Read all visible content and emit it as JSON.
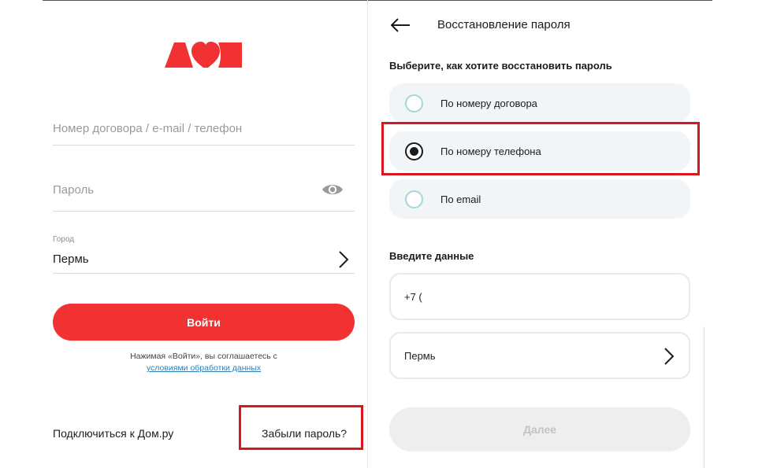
{
  "login": {
    "login_placeholder": "Номер договора / e-mail / телефон",
    "password_placeholder": "Пароль",
    "city_label": "Город",
    "city_value": "Пермь",
    "login_button": "Войти",
    "agreement_text": "Нажимая «Войти», вы соглашаетесь с",
    "terms_link": "условиями обработки данных",
    "connect_link": "Подключиться к Дом.ру",
    "forgot_link": "Забыли пароль?"
  },
  "recovery": {
    "title": "Восстановление пароля",
    "choose_label": "Выберите, как хотите восстановить пароль",
    "options": [
      {
        "label": "По номеру договора",
        "selected": false
      },
      {
        "label": "По номеру телефона",
        "selected": true
      },
      {
        "label": "По email",
        "selected": false
      }
    ],
    "enter_data_label": "Введите данные",
    "phone_value": "+7 (",
    "city_value": "Пермь",
    "next_button": "Далее"
  },
  "colors": {
    "brand_red": "#f23232",
    "highlight_red": "#d7191f",
    "link_blue": "#2f7fb9",
    "radio_unselected": "#a3d7db",
    "option_bg": "#f1f5f8"
  },
  "icons": [
    "brand-logo",
    "eye-icon",
    "chevron-right-icon",
    "back-arrow-icon"
  ]
}
